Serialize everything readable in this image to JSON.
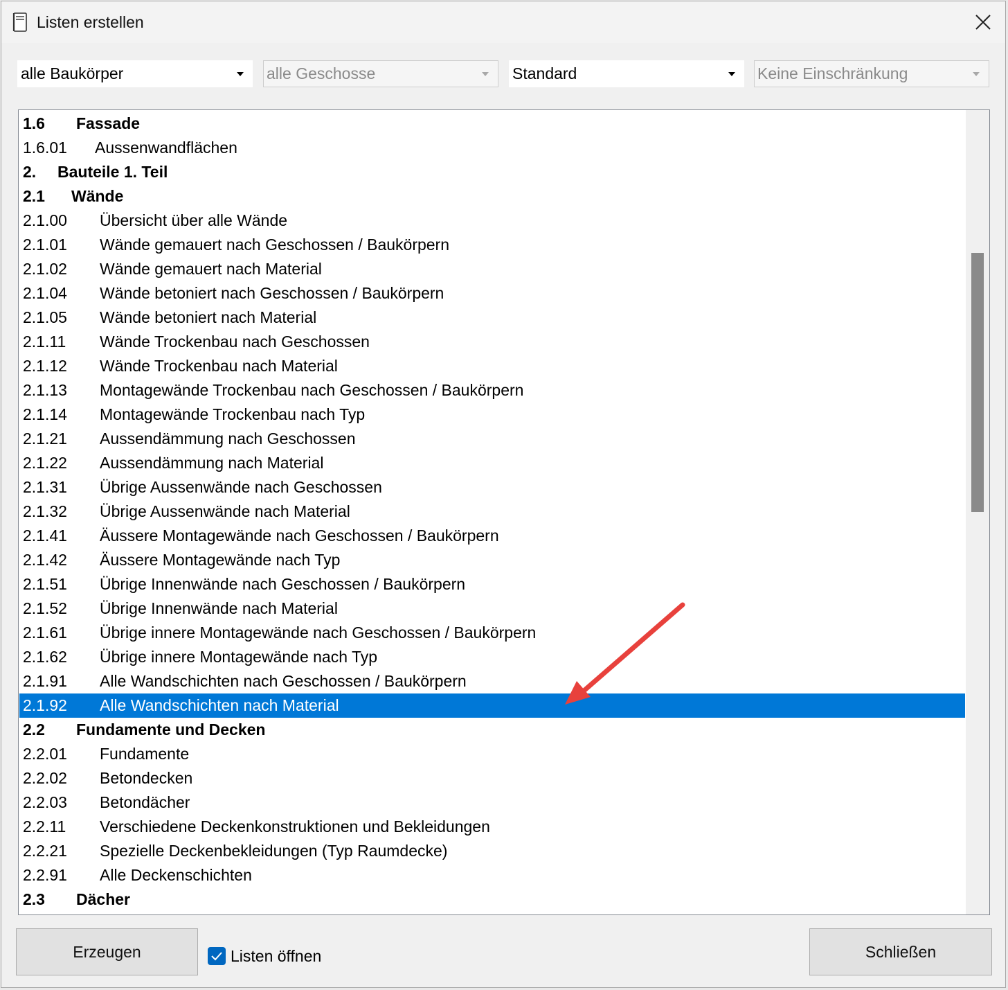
{
  "window": {
    "title": "Listen erstellen"
  },
  "filters": {
    "baukoerper": {
      "value": "alle Baukörper",
      "disabled": false
    },
    "geschosse": {
      "value": "alle Geschosse",
      "disabled": true
    },
    "standard": {
      "value": "Standard",
      "disabled": false
    },
    "einschraenkung": {
      "value": "Keine Einschränkung",
      "disabled": true
    }
  },
  "list": {
    "items": [
      {
        "num": "1.6",
        "label": "Fassade",
        "bold": true
      },
      {
        "num": "1.6.01",
        "label": "Aussenwandflächen",
        "bold": false
      },
      {
        "num": "2.",
        "label": "Bauteile 1. Teil",
        "bold": true
      },
      {
        "num": "2.1",
        "label": "Wände",
        "bold": true
      },
      {
        "num": "2.1.00",
        "label": "Übersicht über alle Wände",
        "bold": false
      },
      {
        "num": "2.1.01",
        "label": "Wände gemauert nach Geschossen / Baukörpern",
        "bold": false
      },
      {
        "num": "2.1.02",
        "label": "Wände gemauert nach Material",
        "bold": false
      },
      {
        "num": "2.1.04",
        "label": "Wände betoniert nach Geschossen / Baukörpern",
        "bold": false
      },
      {
        "num": "2.1.05",
        "label": "Wände betoniert nach Material",
        "bold": false
      },
      {
        "num": "2.1.11",
        "label": "Wände Trockenbau nach Geschossen",
        "bold": false
      },
      {
        "num": "2.1.12",
        "label": "Wände Trockenbau nach Material",
        "bold": false
      },
      {
        "num": "2.1.13",
        "label": "Montagewände Trockenbau nach Geschossen / Baukörpern",
        "bold": false
      },
      {
        "num": "2.1.14",
        "label": "Montagewände Trockenbau nach Typ",
        "bold": false
      },
      {
        "num": "2.1.21",
        "label": "Aussendämmung nach Geschossen",
        "bold": false
      },
      {
        "num": "2.1.22",
        "label": "Aussendämmung nach Material",
        "bold": false
      },
      {
        "num": "2.1.31",
        "label": "Übrige Aussenwände nach Geschossen",
        "bold": false
      },
      {
        "num": "2.1.32",
        "label": "Übrige Aussenwände nach Material",
        "bold": false
      },
      {
        "num": "2.1.41",
        "label": "Äussere Montagewände nach Geschossen / Baukörpern",
        "bold": false
      },
      {
        "num": "2.1.42",
        "label": "Äussere Montagewände nach Typ",
        "bold": false
      },
      {
        "num": "2.1.51",
        "label": "Übrige Innenwände nach Geschossen / Baukörpern",
        "bold": false
      },
      {
        "num": "2.1.52",
        "label": "Übrige Innenwände nach Material",
        "bold": false
      },
      {
        "num": "2.1.61",
        "label": "Übrige innere Montagewände nach Geschossen / Baukörpern",
        "bold": false
      },
      {
        "num": "2.1.62",
        "label": "Übrige innere Montagewände nach Typ",
        "bold": false
      },
      {
        "num": "2.1.91",
        "label": "Alle Wandschichten nach Geschossen / Baukörpern",
        "bold": false
      },
      {
        "num": "2.1.92",
        "label": "Alle Wandschichten nach Material",
        "bold": false,
        "selected": true
      },
      {
        "num": "2.2",
        "label": "Fundamente und Decken",
        "bold": true
      },
      {
        "num": "2.2.01",
        "label": "Fundamente",
        "bold": false
      },
      {
        "num": "2.2.02",
        "label": "Betondecken",
        "bold": false
      },
      {
        "num": "2.2.03",
        "label": "Betondächer",
        "bold": false
      },
      {
        "num": "2.2.11",
        "label": "Verschiedene Deckenkonstruktionen und Bekleidungen",
        "bold": false
      },
      {
        "num": "2.2.21",
        "label": "Spezielle Deckenbekleidungen (Typ Raumdecke)",
        "bold": false
      },
      {
        "num": "2.2.91",
        "label": "Alle Deckenschichten",
        "bold": false
      },
      {
        "num": "2.3",
        "label": "Dächer",
        "bold": true
      }
    ],
    "selection_color": "#0078d7"
  },
  "footer": {
    "create_label": "Erzeugen",
    "open_lists_label": "Listen öffnen",
    "open_lists_checked": true,
    "close_label": "Schließen"
  },
  "annotation": {
    "arrow_color": "#e8413c"
  }
}
